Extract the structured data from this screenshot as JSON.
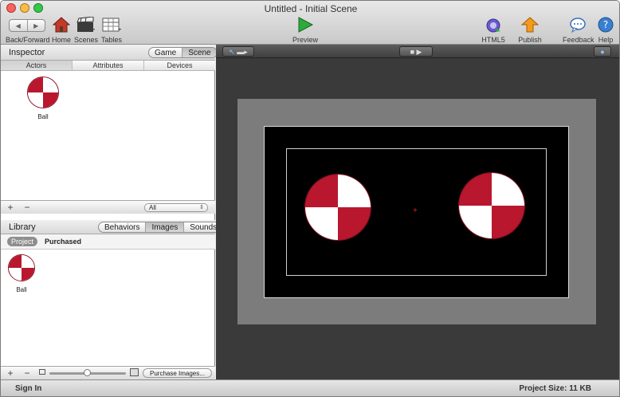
{
  "window": {
    "title": "Untitled - Initial Scene"
  },
  "toolbar": {
    "back_forward_label": "Back/Forward",
    "home_label": "Home",
    "scenes_label": "Scenes",
    "tables_label": "Tables",
    "preview_label": "Preview",
    "html5_preview_label": "HTML5 Preview",
    "publish_label": "Publish",
    "feedback_label": "Feedback",
    "help_label": "Help",
    "icons": [
      "back-icon",
      "forward-icon",
      "home-icon",
      "scenes-icon",
      "tables-icon",
      "preview-play-icon",
      "html5-preview-icon",
      "publish-icon",
      "feedback-icon",
      "help-icon"
    ]
  },
  "inspector": {
    "title": "Inspector",
    "mode_options": [
      "Game",
      "Scene"
    ],
    "selected_mode": "Scene",
    "tabs": [
      "Actors",
      "Attributes",
      "Devices"
    ],
    "selected_tab": "Actors",
    "actors": [
      {
        "name": "Ball"
      }
    ],
    "filter_value": "All"
  },
  "library": {
    "title": "Library",
    "tabs": [
      "Behaviors",
      "Images",
      "Sounds"
    ],
    "selected_tab": "Images",
    "subtabs": [
      "Project",
      "Purchased"
    ],
    "selected_subtab": "Project",
    "items": [
      {
        "name": "Ball"
      }
    ],
    "purchase_button": "Purchase Images..."
  },
  "status": {
    "sign_in": "Sign In",
    "project_size": "Project Size: 11 KB"
  },
  "colors": {
    "ball_red": "#b8172e",
    "stage_black": "#000000"
  }
}
